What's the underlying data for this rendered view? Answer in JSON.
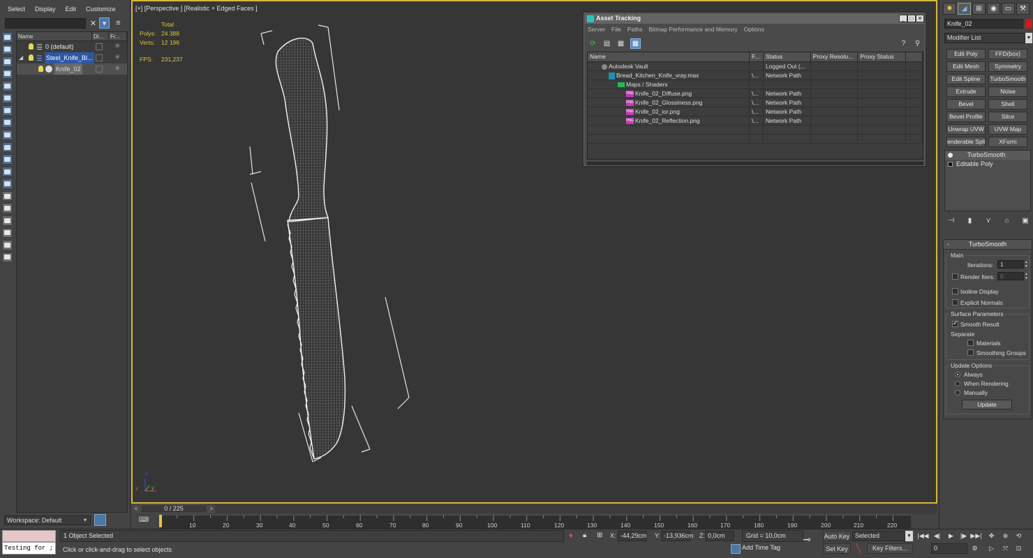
{
  "scene_explorer": {
    "menu": [
      "Select",
      "Display",
      "Edit",
      "Customize"
    ],
    "search_value": "",
    "columns": [
      "Name",
      "Di...",
      "Fr..."
    ],
    "rows": [
      {
        "label": "0 (default)"
      },
      {
        "label": "Steel_Knife_Bl..."
      },
      {
        "label": "Knife_02"
      }
    ],
    "workspace": "Workspace: Default"
  },
  "viewport": {
    "label": "[+] [Perspective ] [Realistic + Edged Faces ]",
    "stats": {
      "total_label": "Total",
      "polys_label": "Polys:",
      "polys": "24 388",
      "verts_label": "Verts:",
      "verts": "12 196",
      "fps_label": "FPS:",
      "fps": "231,237"
    },
    "axis": {
      "x": "x",
      "y": "y",
      "z": "z"
    }
  },
  "asset_tracking": {
    "title": "Asset Tracking",
    "menu": [
      "Server",
      "File",
      "Paths",
      "Bitmap Performance and Memory",
      "Options"
    ],
    "columns": [
      "Name",
      "F...",
      "Status",
      "Proxy Resolu...",
      "Proxy Status"
    ],
    "rows": [
      {
        "name": "Autodesk Vault",
        "f": "",
        "status": "Logged Out (..."
      },
      {
        "name": "Bread_Kitchen_Knife_vray.max",
        "f": "\\...",
        "status": "Network Path"
      },
      {
        "name": "Maps / Shaders",
        "f": "",
        "status": ""
      },
      {
        "name": "Knife_02_Diffuse.png",
        "f": "\\...",
        "status": "Network Path"
      },
      {
        "name": "Knife_02_Glossiness.png",
        "f": "\\...",
        "status": "Network Path"
      },
      {
        "name": "Knife_02_ior.png",
        "f": "\\...",
        "status": "Network Path"
      },
      {
        "name": "Knife_02_Reflection.png",
        "f": "\\...",
        "status": "Network Path"
      }
    ],
    "png_badge": "PNG",
    "help_icon": "?"
  },
  "command_panel": {
    "object_name": "Knife_02",
    "object_color": "#c81d1d",
    "modifier_list": "Modifier List",
    "modifier_buttons": [
      "Edit Poly",
      "FFD(box)",
      "Edit Mesh",
      "Symmetry",
      "Edit Spline",
      "TurboSmooth",
      "Extrude",
      "Noise",
      "Bevel",
      "Shell",
      "Bevel Profile",
      "Slice",
      "Unwrap UVW",
      "UVW Map",
      "enderable Splin",
      "XForm"
    ],
    "stack": [
      "TurboSmooth",
      "Editable Poly"
    ],
    "rollout": {
      "title": "TurboSmooth",
      "collapse": "-",
      "main_group": "Main",
      "iterations_label": "Iterations:",
      "iterations": "1",
      "render_iters_label": "Render Iters:",
      "render_iters": "0",
      "isoline_label": "Isoline Display",
      "explicit_normals_label": "Explicit Normals",
      "surface_group": "Surface Parameters",
      "smooth_result_label": "Smooth Result",
      "separate_label": "Separate",
      "materials_label": "Materials",
      "smoothing_groups_label": "Smoothing Groups",
      "update_group": "Update Options",
      "always_label": "Always",
      "when_rendering_label": "When Rendering",
      "manually_label": "Manually",
      "update_button": "Update"
    }
  },
  "timeline": {
    "slider": "0 / 225",
    "ticks": [
      "10",
      "20",
      "30",
      "40",
      "50",
      "60",
      "70",
      "80",
      "90",
      "100",
      "110",
      "120",
      "130",
      "140",
      "150",
      "160",
      "170",
      "180",
      "190",
      "200",
      "210",
      "220"
    ]
  },
  "status": {
    "maxscript": "Testing for ;",
    "selection": "1 Object Selected",
    "prompt": "Click or click-and-drag to select objects",
    "x_label": "X:",
    "x": "-44,29cm",
    "y_label": "Y:",
    "y": "-13,936cm",
    "z_label": "Z:",
    "z": "0,0cm",
    "grid": "Grid = 10,0cm",
    "add_time_tag": "Add Time Tag",
    "auto_key": "Auto Key",
    "set_key": "Set Key",
    "selected": "Selected",
    "key_filters": "Key Filters...",
    "frame": "0"
  },
  "colors": {
    "viewport_border": "#d5b83b",
    "stats": "#e2c634",
    "selection_blue": "#2e58a6"
  }
}
